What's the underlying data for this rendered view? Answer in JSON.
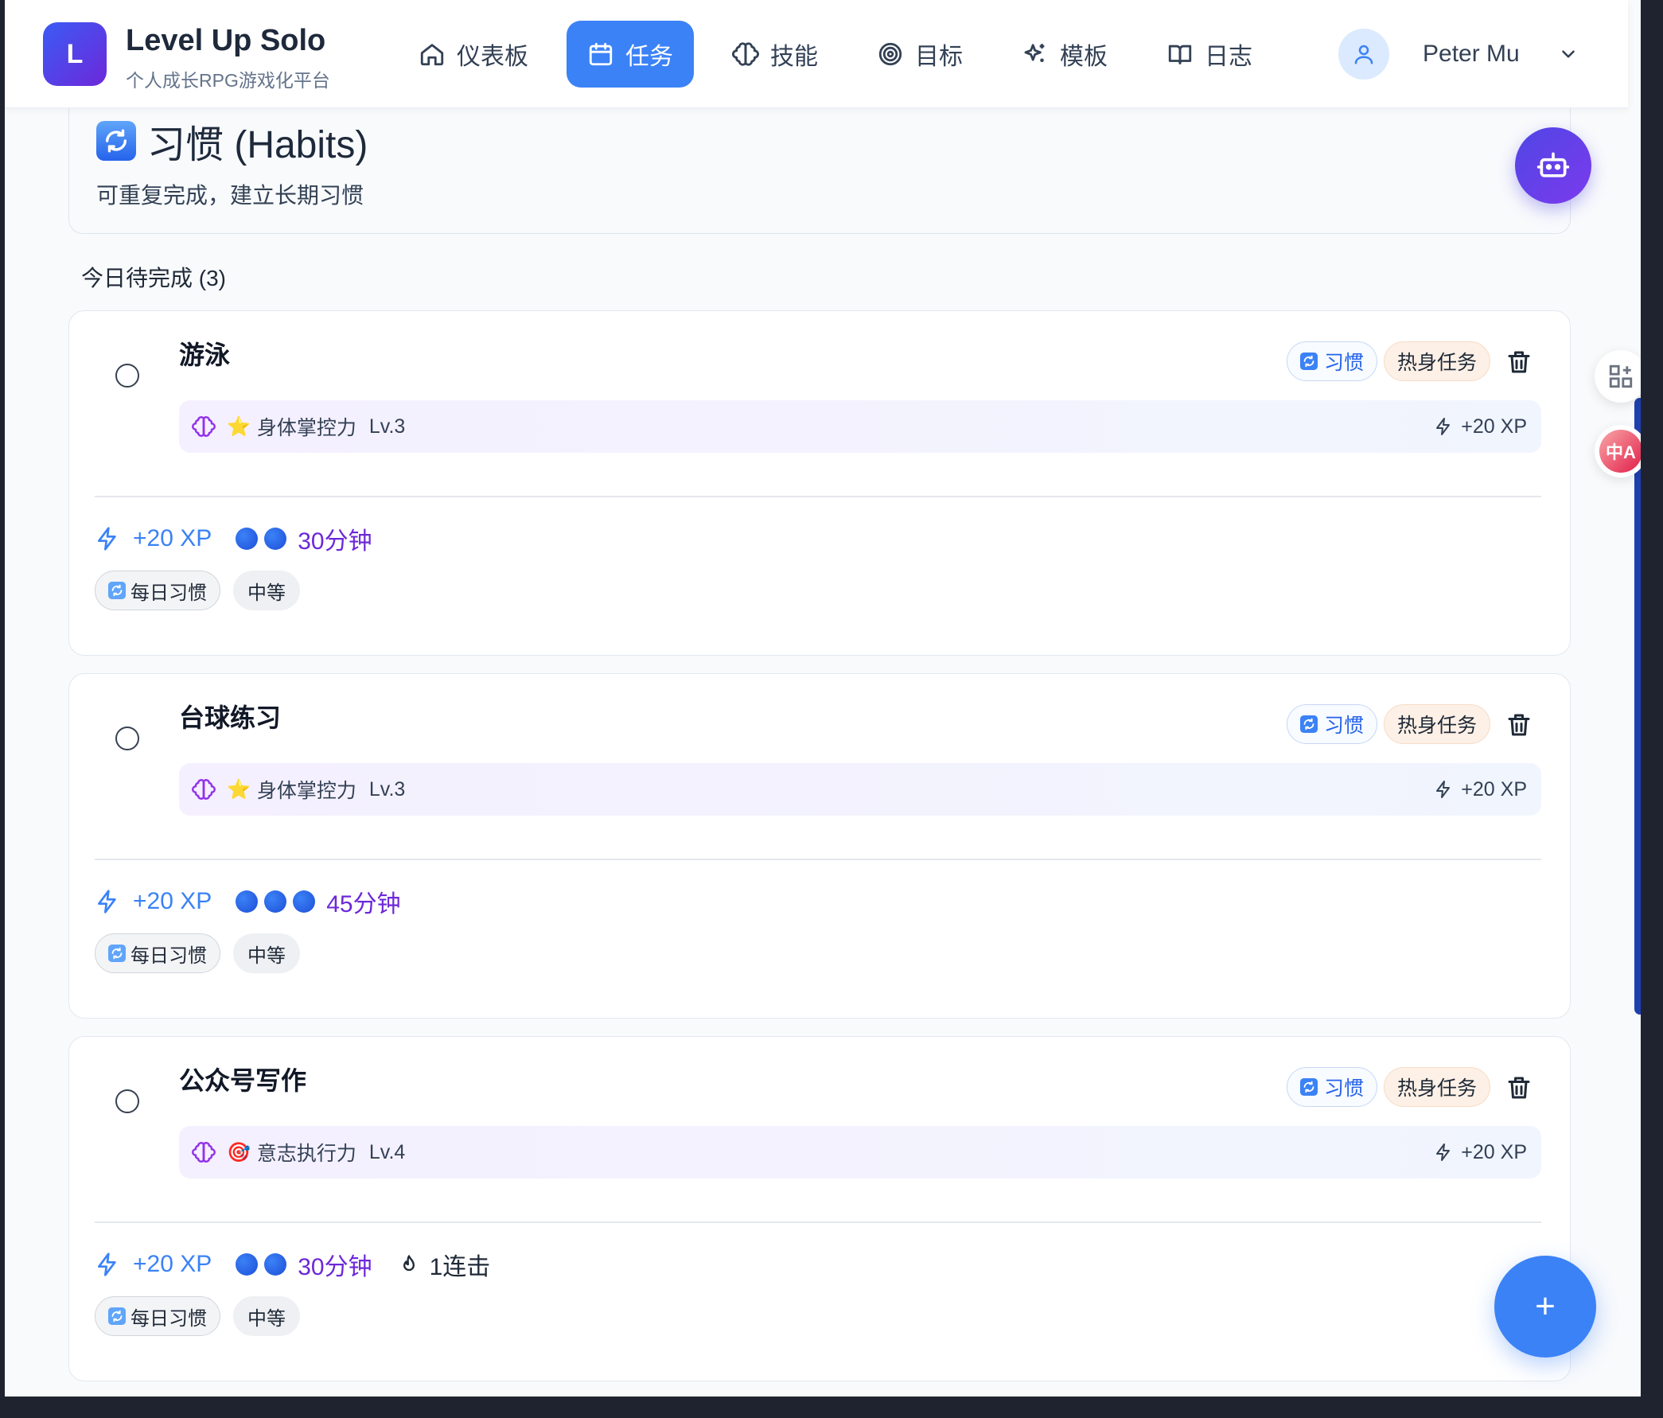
{
  "app": {
    "logo_letter": "L",
    "title": "Level Up Solo",
    "subtitle": "个人成长RPG游戏化平台"
  },
  "nav": [
    {
      "label": "仪表板",
      "icon": "home-icon",
      "active": false
    },
    {
      "label": "任务",
      "icon": "calendar-icon",
      "active": true
    },
    {
      "label": "技能",
      "icon": "brain-icon",
      "active": false
    },
    {
      "label": "目标",
      "icon": "target-icon",
      "active": false
    },
    {
      "label": "模板",
      "icon": "sparkles-icon",
      "active": false
    },
    {
      "label": "日志",
      "icon": "book-icon",
      "active": false
    }
  ],
  "user": {
    "name": "Peter Mu"
  },
  "section": {
    "emoji": "🔄",
    "title": "习惯 (Habits)",
    "subtitle": "可重复完成，建立长期习惯"
  },
  "today_label": "今日待完成 (3)",
  "tasks": [
    {
      "title": "游泳",
      "badge_type": "习惯",
      "badge_category": "热身任务",
      "skill": {
        "emoji": "⭐",
        "name": "身体掌控力",
        "level": "Lv.3",
        "xp": "+20 XP"
      },
      "xp": "+20 XP",
      "dots": 2,
      "duration": "30分钟",
      "streak": "",
      "tags": {
        "habit": "每日习惯",
        "difficulty": "中等"
      }
    },
    {
      "title": "台球练习",
      "badge_type": "习惯",
      "badge_category": "热身任务",
      "skill": {
        "emoji": "⭐",
        "name": "身体掌控力",
        "level": "Lv.3",
        "xp": "+20 XP"
      },
      "xp": "+20 XP",
      "dots": 3,
      "duration": "45分钟",
      "streak": "",
      "tags": {
        "habit": "每日习惯",
        "difficulty": "中等"
      }
    },
    {
      "title": "公众号写作",
      "badge_type": "习惯",
      "badge_category": "热身任务",
      "skill": {
        "emoji": "🎯",
        "name": "意志执行力",
        "level": "Lv.4",
        "xp": "+20 XP"
      },
      "xp": "+20 XP",
      "dots": 2,
      "duration": "30分钟",
      "streak": "1连击",
      "tags": {
        "habit": "每日习惯",
        "difficulty": "中等"
      }
    }
  ],
  "fab": {
    "add_label": "+"
  },
  "translate_widget": {
    "label": "中A"
  },
  "colors": {
    "primary": "#3b82f6",
    "brand_start": "#3b5bf5",
    "brand_end": "#6d28d9",
    "duration": "#6d28d9"
  }
}
